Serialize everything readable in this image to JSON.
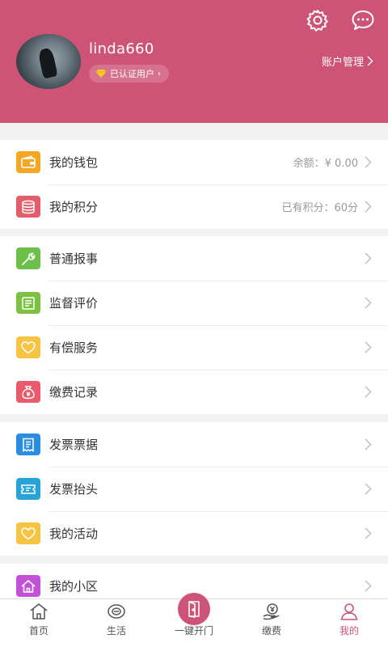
{
  "header": {
    "username": "linda660",
    "verified_label": "已认证用户",
    "account_manage_label": "账户管理"
  },
  "sections": [
    {
      "items": [
        {
          "label": "我的钱包",
          "value": "余额：¥ 0.00",
          "icon": "wallet-icon",
          "color": "#f5a623"
        },
        {
          "label": "我的积分",
          "value": "已有积分：60分",
          "icon": "points-stack-icon",
          "color": "#e35d6a"
        }
      ]
    },
    {
      "items": [
        {
          "label": "普通报事",
          "value": "",
          "icon": "wrench-icon",
          "color": "#6cc04a"
        },
        {
          "label": "监督评价",
          "value": "",
          "icon": "note-icon",
          "color": "#7cc142"
        },
        {
          "label": "有偿服务",
          "value": "",
          "icon": "heart-icon",
          "color": "#f6c342"
        },
        {
          "label": "缴费记录",
          "value": "",
          "icon": "money-bag-icon",
          "color": "#e95b6b"
        }
      ]
    },
    {
      "items": [
        {
          "label": "发票票据",
          "value": "",
          "icon": "receipt-icon",
          "color": "#2a8de0"
        },
        {
          "label": "发票抬头",
          "value": "",
          "icon": "ticket-icon",
          "color": "#27a3d8"
        },
        {
          "label": "我的活动",
          "value": "",
          "icon": "heart-icon",
          "color": "#f6c342"
        }
      ]
    },
    {
      "items": [
        {
          "label": "我的小区",
          "value": "",
          "icon": "home-icon",
          "color": "#c44fd8"
        }
      ]
    }
  ],
  "tabs": [
    {
      "label": "首页",
      "icon": "home-outline-icon"
    },
    {
      "label": "生活",
      "icon": "life-icon"
    },
    {
      "label": "一键开门",
      "icon": "door-icon"
    },
    {
      "label": "缴费",
      "icon": "payment-icon"
    },
    {
      "label": "我的",
      "icon": "user-icon"
    }
  ],
  "colors": {
    "brand": "#cd5377"
  }
}
